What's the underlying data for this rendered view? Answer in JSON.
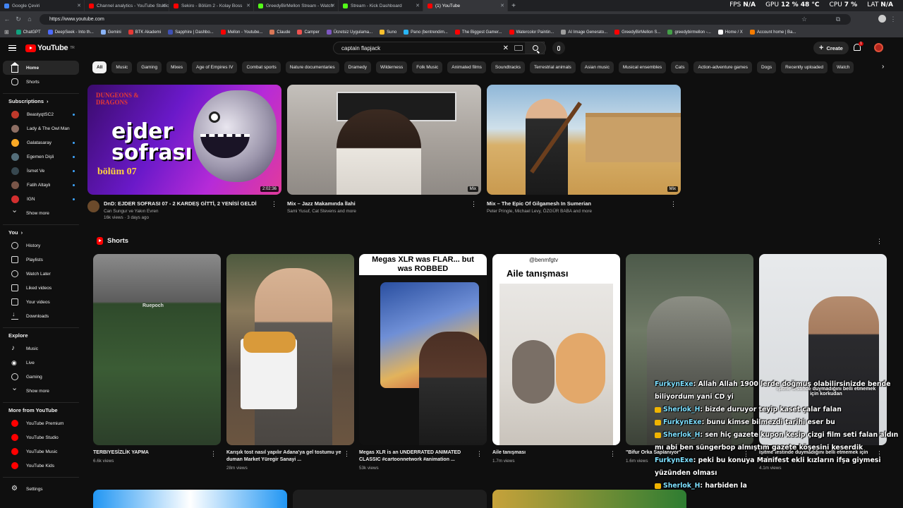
{
  "browser": {
    "tabs": [
      {
        "title": "Google Çeviri",
        "color": "#4285f4"
      },
      {
        "title": "Channel analytics - YouTube Studio",
        "color": "#ff0000"
      },
      {
        "title": "Sekiro - Bölüm 2 - Kolay Boss",
        "color": "#ff0000"
      },
      {
        "title": "GreedyBirMellon Stream - Watch",
        "color": "#53fc18"
      },
      {
        "title": "Stream - Kick Dashboard",
        "color": "#53fc18"
      },
      {
        "title": "(1) YouTube",
        "color": "#ff0000"
      }
    ],
    "url": "https://www.youtube.com",
    "bookmarks": [
      {
        "label": "ChatGPT",
        "color": "#10a37f"
      },
      {
        "label": "DeepSeek - Into th...",
        "color": "#4d6bfe"
      },
      {
        "label": "Gemini",
        "color": "#8ab4f8"
      },
      {
        "label": "BTK Akademi",
        "color": "#e53935"
      },
      {
        "label": "Sapphire | Dashbo...",
        "color": "#3f51b5"
      },
      {
        "label": "Mellon - Youtube...",
        "color": "#ff0000"
      },
      {
        "label": "Claude",
        "color": "#d97757"
      },
      {
        "label": "Camper",
        "color": "#ef5350"
      },
      {
        "label": "Ücretsiz Uygulama...",
        "color": "#7e57c2"
      },
      {
        "label": "Suno",
        "color": "#fbc02d"
      },
      {
        "label": "Pano (bentrendim...",
        "color": "#29b6f6"
      },
      {
        "label": "The Biggest Gamer...",
        "color": "#ff0000"
      },
      {
        "label": "Watercolor Paintin...",
        "color": "#ff0000"
      },
      {
        "label": "AI Image Generato...",
        "color": "#9e9e9e"
      },
      {
        "label": "GreedyBirMellon S...",
        "color": "#ff0000"
      },
      {
        "label": "greedybirmellon -...",
        "color": "#43a047"
      },
      {
        "label": "Home / X",
        "color": "#ffffff"
      },
      {
        "label": "Account home | Ba...",
        "color": "#f57c00"
      }
    ]
  },
  "overlay_stats": {
    "fps": "FPS",
    "fps_val": "N/A",
    "gpu": "GPU",
    "gpu_val": "12 % 48 °C",
    "cpu": "CPU",
    "cpu_val": "7 %",
    "lat": "LAT",
    "lat_val": "N/A"
  },
  "masthead": {
    "logo_text": "YouTube",
    "region": "TR",
    "search_query": "captain flapjack",
    "create_label": "Create",
    "notification_count": "1"
  },
  "sidebar": {
    "main": [
      {
        "label": "Home",
        "icon": "home-icon"
      },
      {
        "label": "Shorts",
        "icon": "shorts-icon"
      }
    ],
    "subscriptions_title": "Subscriptions",
    "subscriptions": [
      {
        "label": "BeastyqtSC2",
        "color": "#c0392b"
      },
      {
        "label": "Lady & The Owl Man",
        "color": "#8d6e63"
      },
      {
        "label": "Galatasaray",
        "color": "#f9a825"
      },
      {
        "label": "Egemen Dişli",
        "color": "#546e7a"
      },
      {
        "label": "İsmet Ve",
        "color": "#37474f"
      },
      {
        "label": "Fatih Altaylı",
        "color": "#795548"
      },
      {
        "label": "IGN",
        "color": "#d32f2f"
      }
    ],
    "show_more": "Show more",
    "you_title": "You",
    "you": [
      {
        "label": "History",
        "icon": "history-icon"
      },
      {
        "label": "Playlists",
        "icon": "playlists-icon"
      },
      {
        "label": "Watch Later",
        "icon": "watch-later-icon"
      },
      {
        "label": "Liked videos",
        "icon": "liked-videos-icon"
      },
      {
        "label": "Your videos",
        "icon": "your-videos-icon"
      },
      {
        "label": "Downloads",
        "icon": "downloads-icon"
      }
    ],
    "explore_title": "Explore",
    "explore": [
      {
        "label": "Music",
        "icon": "music-icon"
      },
      {
        "label": "Live",
        "icon": "live-icon"
      },
      {
        "label": "Gaming",
        "icon": "gaming-icon"
      }
    ],
    "explore_more": "Show more",
    "more_title": "More from YouTube",
    "more": [
      {
        "label": "YouTube Premium"
      },
      {
        "label": "YouTube Studio"
      },
      {
        "label": "YouTube Music"
      },
      {
        "label": "YouTube Kids"
      }
    ],
    "settings": "Settings"
  },
  "chips": [
    "All",
    "Music",
    "Gaming",
    "Mixes",
    "Age of Empires IV",
    "Combat sports",
    "Nature documentaries",
    "Dramedy",
    "Wilderness",
    "Folk Music",
    "Animated films",
    "Soundtracks",
    "Terrestrial animals",
    "Asian music",
    "Musical ensembles",
    "Cats",
    "Action-adventure games",
    "Dogs",
    "Recently uploaded",
    "Watch"
  ],
  "videos": [
    {
      "title": "DnD: EJDER SOFRASI 07 - 2 KARDEŞ GİTTİ, 2 YENİSİ GELDİ",
      "channel": "Can Sungur ve Yakın Evren",
      "meta": "16k views · 3 days ago",
      "badge": "2:02:36",
      "thumb_text": "ejder sofrası",
      "thumb_brand": "DUNGEONS & DRAGONS",
      "thumb_sub": "bölüm 07"
    },
    {
      "title": "Mix – Jazz Makamında İlahi",
      "channel": "Sami Yusuf, Cat Stevens and more",
      "meta": "",
      "badge": "Mix"
    },
    {
      "title": "Mix – The Epic Of Gilgamesh In Sumerian",
      "channel": "Peter Pringle, Michael Levy, ÖZGÜR BABA and more",
      "meta": "",
      "badge": "Mix"
    }
  ],
  "shorts_title": "Shorts",
  "shorts": [
    {
      "title": "TERBIYESİZLİK YAPMA",
      "views": "6.6k views",
      "overlay": "Ruepoch"
    },
    {
      "title": "Karışık tost nasıl yapılır Adana'ya gel tostumu ye duman Market Yüregir Sanayi ...",
      "views": "28m views",
      "overlay": ""
    },
    {
      "title": "Megas XLR is an UNDERRATED ANIMATED CLASSIC #cartoonnetwork #animation ...",
      "views": "53k views",
      "overlay": "Megas XLR was FLAR... but was ROBBED"
    },
    {
      "title": "Aile tanışması",
      "views": "1.7m views",
      "overlay": "Aile tanışması",
      "handle": "@benmfgtv"
    },
    {
      "title": "\"Bifur Orka Saplanıyor\"",
      "views": "1.6m views",
      "overlay": ""
    },
    {
      "title": "İşitme testinde duymadığını belli etmemek için korkudan ...",
      "views": "4.1m views",
      "overlay": "İşitme testinde duymadığını belli etmemek için korkudan"
    }
  ],
  "chat": [
    {
      "user": "FurkynExe",
      "msg": ": Allah Allah 1900 lerde doğmuş olabilirsinizde bende biliyordum yani CD yi"
    },
    {
      "user": "Sherlok_H",
      "msg": ": bizde duruyor teyip kaset çalar falan"
    },
    {
      "user": "FurkynExe",
      "msg": ": bunu kimse bilmezdi tarihi eser bu"
    },
    {
      "user": "Sherlok_H",
      "msg": ": sen hiç gazete kupon kesip çizgi film seti falan aldın mı abi ben süngerbop almıştım gazete köşesini keserdik"
    },
    {
      "user": "FurkynExe",
      "msg": ": peki bu konuya Manifest ekli kızların ifşa giymesi yüzünden olması"
    },
    {
      "user": "Sherlok_H",
      "msg": ": harbiden la"
    }
  ]
}
